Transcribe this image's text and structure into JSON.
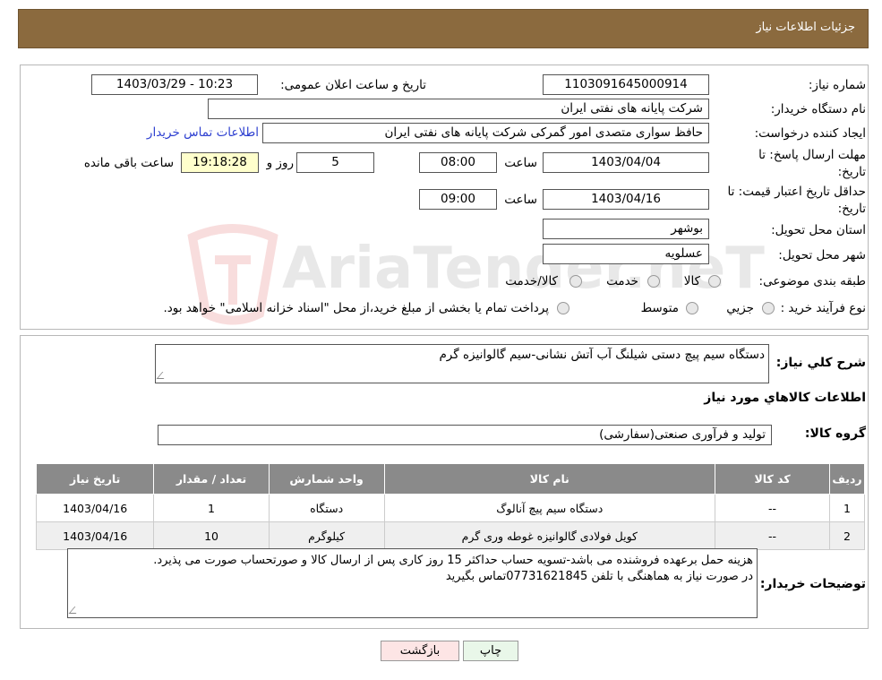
{
  "header": {
    "title": "جزئیات اطلاعات نیاز"
  },
  "form": {
    "need_number_label": "شماره نیاز:",
    "need_number": "1103091645000914",
    "announce_label": "تاریخ و ساعت اعلان عمومی:",
    "announce_value": "1403/03/29 - 10:23",
    "buyer_org_label": "نام دستگاه خریدار:",
    "buyer_org": "شرکت پایانه های نفتی ایران",
    "creator_label": "ایجاد کننده درخواست:",
    "creator": "حافظ سواری متصدی امور گمرکی شرکت پایانه های نفتی ایران",
    "contact_link": "اطلاعات تماس خریدار",
    "deadline_label_1": "مهلت ارسال پاسخ: تا",
    "deadline_label_2": "تاریخ:",
    "deadline_date": "1403/04/04",
    "time_label": "ساعت",
    "deadline_time": "08:00",
    "days": "5",
    "days_label": "روز و",
    "remaining_time": "19:18:28",
    "remaining_label": "ساعت باقی مانده",
    "validity_label_1": "حداقل تاریخ اعتبار قیمت: تا",
    "validity_label_2": "تاریخ:",
    "validity_date": "1403/04/16",
    "validity_time": "09:00",
    "province_label": "استان محل تحویل:",
    "province": "بوشهر",
    "city_label": "شهر محل تحویل:",
    "city": "عسلویه",
    "category_label": "طبقه بندی موضوعی:",
    "category_options": [
      "کالا",
      "خدمت",
      "کالا/خدمت"
    ],
    "process_label": "نوع فرآیند خرید :",
    "process_options": [
      "جزیي",
      "متوسط"
    ],
    "process_note": "پرداخت تمام یا بخشی از مبلغ خرید،از محل \"اسناد خزانه اسلامی\" خواهد بود."
  },
  "summary": {
    "label": "شرح کلي نياز:",
    "text": "دستگاه سیم پیچ دستی شیلنگ آب آتش نشانی-سیم گالوانیزه گرم",
    "goods_title": "اطلاعات کالاهاي مورد نياز",
    "group_label": "گروه کالا:",
    "group_value": "تولید و فرآوری صنعتی(سفارشی)"
  },
  "table": {
    "headers": [
      "رديف",
      "کد کالا",
      "نام کالا",
      "واحد شمارش",
      "تعداد / مقدار",
      "تاریخ نیاز"
    ],
    "rows": [
      [
        "1",
        "--",
        "دستگاه سیم پیچ آنالوگ",
        "دستگاه",
        "1",
        "1403/04/16"
      ],
      [
        "2",
        "--",
        "کویل فولادی گالوانیزه غوطه وری گرم",
        "کیلوگرم",
        "10",
        "1403/04/16"
      ]
    ]
  },
  "notes": {
    "label": "توضیحات خریدار:",
    "line1": "هزینه حمل برعهده فروشنده می باشد-تسویه حساب حداکثر 15 روز کاری پس از ارسال کالا و صورتحساب صورت می پذیرد.",
    "line2": "در صورت نیاز به هماهنگی با تلفن 07731621845تماس بگیرید"
  },
  "buttons": {
    "print": "چاپ",
    "back": "بازگشت"
  },
  "colors": {
    "header_bg": "#8b6a3e",
    "back_button_bg": "#fde5e5",
    "print_button_bg": "#e9f7e9",
    "link": "#2d3fd0",
    "table_header": "#8a8a8a"
  },
  "watermark": {
    "text": "AriaTender.neT"
  }
}
